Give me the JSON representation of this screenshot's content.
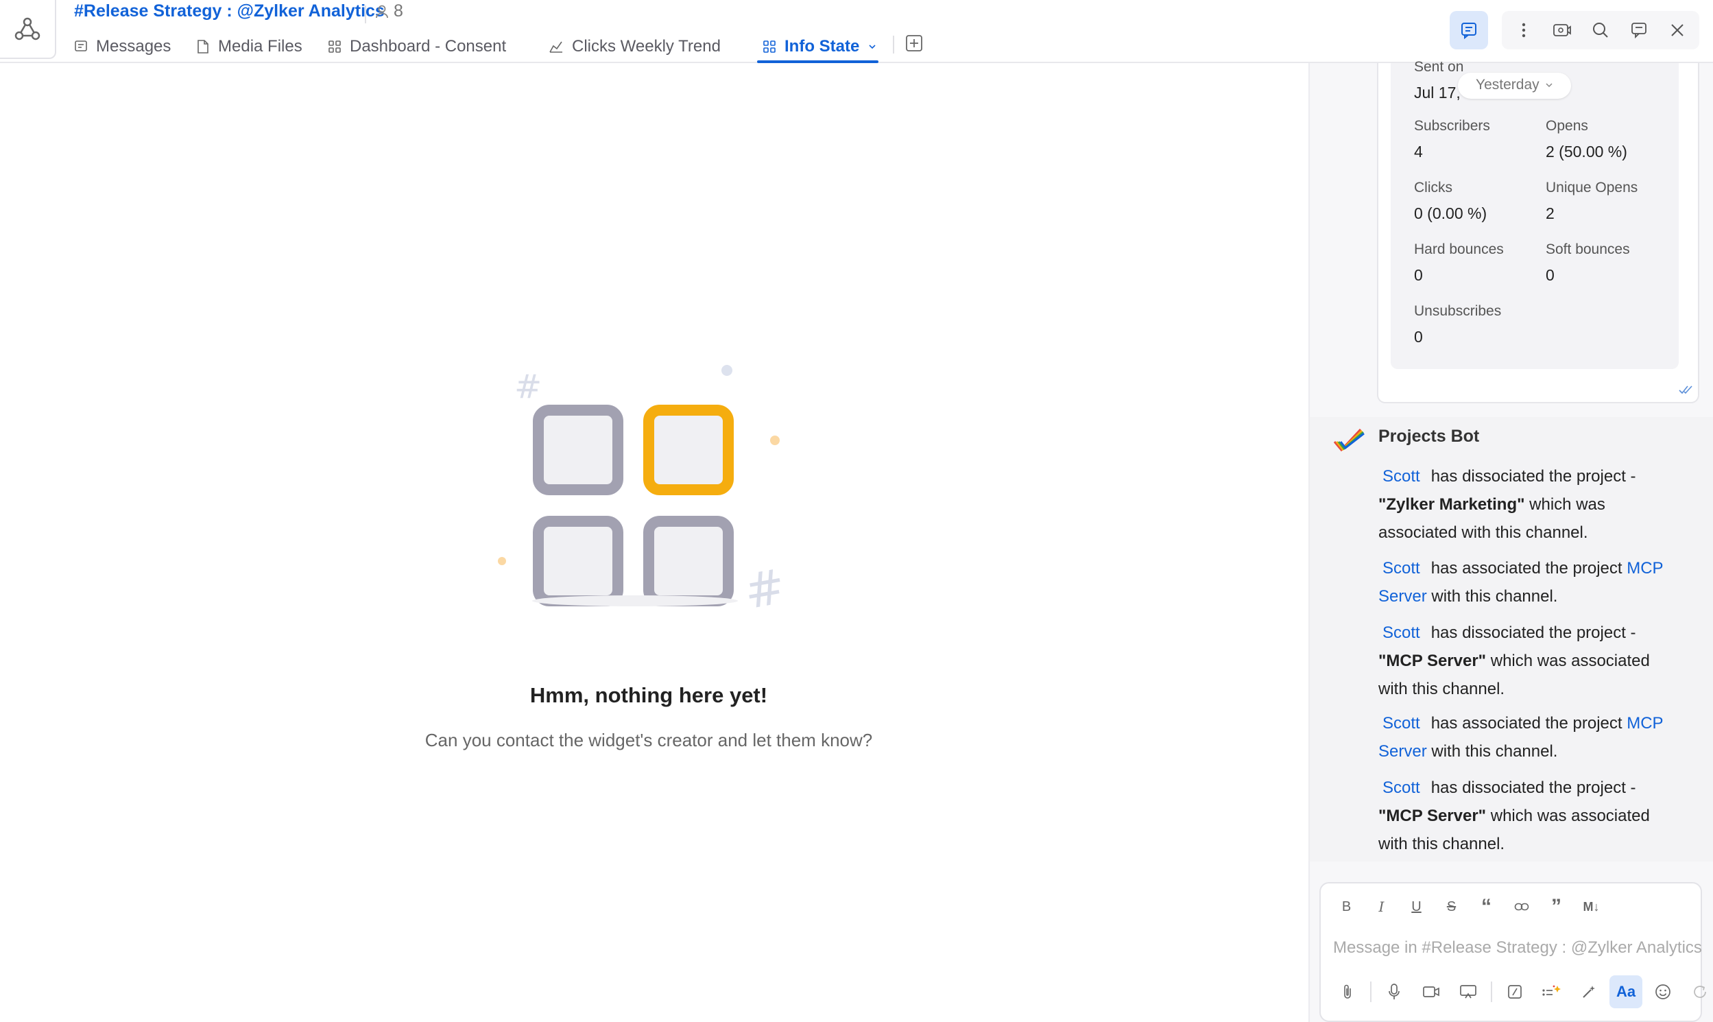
{
  "header": {
    "channel_title": "#Release Strategy : @Zylker Analytics",
    "member_count": "8",
    "tabs": [
      {
        "label": "Messages",
        "icon": "message-icon"
      },
      {
        "label": "Media Files",
        "icon": "file-icon"
      },
      {
        "label": "Dashboard - Consent",
        "icon": "dashboard-icon"
      },
      {
        "label": "Clicks Weekly Trend",
        "icon": "chart-icon"
      },
      {
        "label": "Info State",
        "icon": "grid-icon",
        "active": true
      }
    ],
    "add_tab_icon": "plus-square-icon",
    "right_icons": [
      "chat-icon",
      "more-vertical-icon",
      "video-icon",
      "search-icon",
      "thread-icon",
      "close-icon"
    ]
  },
  "empty_state": {
    "title": "Hmm, nothing here yet!",
    "subtitle": "Can you contact the widget's creator and let them know?",
    "accent_color": "#f5ad0f"
  },
  "stats_card": {
    "sent_on_label": "Sent on",
    "sent_on_value": "Jul 17,",
    "date_pill": "Yesterday",
    "stats": [
      {
        "label": "Subscribers",
        "value": "4"
      },
      {
        "label": "Opens",
        "value": "2 (50.00 %)"
      },
      {
        "label": "Clicks",
        "value": "0 (0.00 %)"
      },
      {
        "label": "Unique Opens",
        "value": "2"
      },
      {
        "label": "Hard bounces",
        "value": "0"
      },
      {
        "label": "Soft bounces",
        "value": "0"
      },
      {
        "label": "Unsubscribes",
        "value": "0"
      }
    ]
  },
  "bot": {
    "name": "Projects Bot",
    "messages": [
      {
        "user": "Scott",
        "text1": "has dissociated the project -",
        "project": "\"Zylker Marketing\"",
        "text2": " which was associated with this channel."
      },
      {
        "user": "Scott",
        "text1": "has associated the project ",
        "project_link": "MCP Server",
        "text2": " with this channel."
      },
      {
        "user": "Scott",
        "text1": "has dissociated the project -",
        "project": "\"MCP Server\"",
        "text2": " which was associated with this channel."
      },
      {
        "user": "Scott",
        "text1": "has associated the project ",
        "project_link": "MCP Server",
        "text2": " with this channel."
      },
      {
        "user": "Scott",
        "text1": "has dissociated the project -",
        "project": "\"MCP Server\"",
        "text2": " which was associated with this channel."
      }
    ]
  },
  "composer": {
    "placeholder": "Message in #Release Strategy : @Zylker Analytics",
    "format_buttons": [
      "B",
      "I",
      "U",
      "S",
      "“",
      "link",
      "”",
      "M↓"
    ],
    "aa_label": "Aa"
  }
}
